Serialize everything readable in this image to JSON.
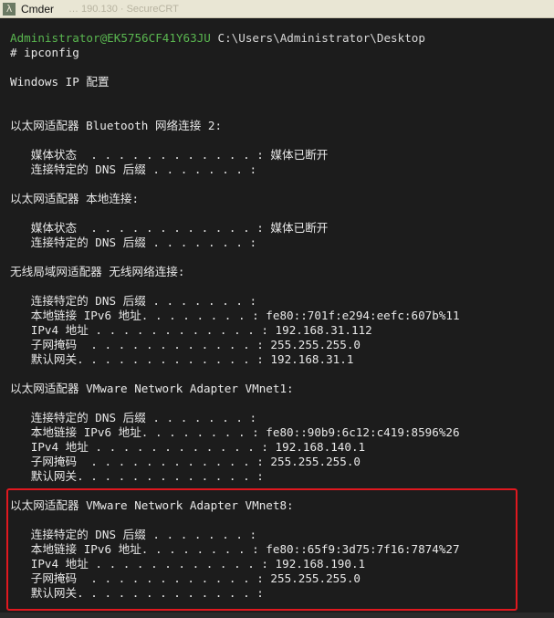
{
  "window": {
    "title": "Cmder",
    "icon_glyph": "λ",
    "background_ghost_text": "… 190.130 · SecureCRT",
    "annotation_color": "#e0181f"
  },
  "prompt": {
    "user": "Administrator@EK5756CF41Y63JU",
    "path": "C:\\Users\\Administrator\\Desktop"
  },
  "command_line": "# ipconfig",
  "windows_ip_header": "Windows IP 配置",
  "adapters": [
    {
      "header": "以太网适配器 Bluetooth 网络连接 2:",
      "rows": [
        "   媒体状态  . . . . . . . . . . . . : 媒体已断开",
        "   连接特定的 DNS 后缀 . . . . . . . :"
      ]
    },
    {
      "header": "以太网适配器 本地连接:",
      "rows": [
        "   媒体状态  . . . . . . . . . . . . : 媒体已断开",
        "   连接特定的 DNS 后缀 . . . . . . . :"
      ]
    },
    {
      "header": "无线局域网适配器 无线网络连接:",
      "rows": [
        "   连接特定的 DNS 后缀 . . . . . . . :",
        "   本地链接 IPv6 地址. . . . . . . . : fe80::701f:e294:eefc:607b%11",
        "   IPv4 地址 . . . . . . . . . . . . : 192.168.31.112",
        "   子网掩码  . . . . . . . . . . . . : 255.255.255.0",
        "   默认网关. . . . . . . . . . . . . : 192.168.31.1"
      ]
    },
    {
      "header": "以太网适配器 VMware Network Adapter VMnet1:",
      "rows": [
        "   连接特定的 DNS 后缀 . . . . . . . :",
        "   本地链接 IPv6 地址. . . . . . . . : fe80::90b9:6c12:c419:8596%26",
        "   IPv4 地址 . . . . . . . . . . . . : 192.168.140.1",
        "   子网掩码  . . . . . . . . . . . . : 255.255.255.0",
        "   默认网关. . . . . . . . . . . . . :"
      ]
    },
    {
      "header": "以太网适配器 VMware Network Adapter VMnet8:",
      "rows": [
        "   连接特定的 DNS 后缀 . . . . . . . :",
        "   本地链接 IPv6 地址. . . . . . . . : fe80::65f9:3d75:7f16:7874%27",
        "   IPv4 地址 . . . . . . . . . . . . : 192.168.190.1",
        "   子网掩码  . . . . . . . . . . . . : 255.255.255.0",
        "   默认网关. . . . . . . . . . . . . :"
      ]
    }
  ]
}
